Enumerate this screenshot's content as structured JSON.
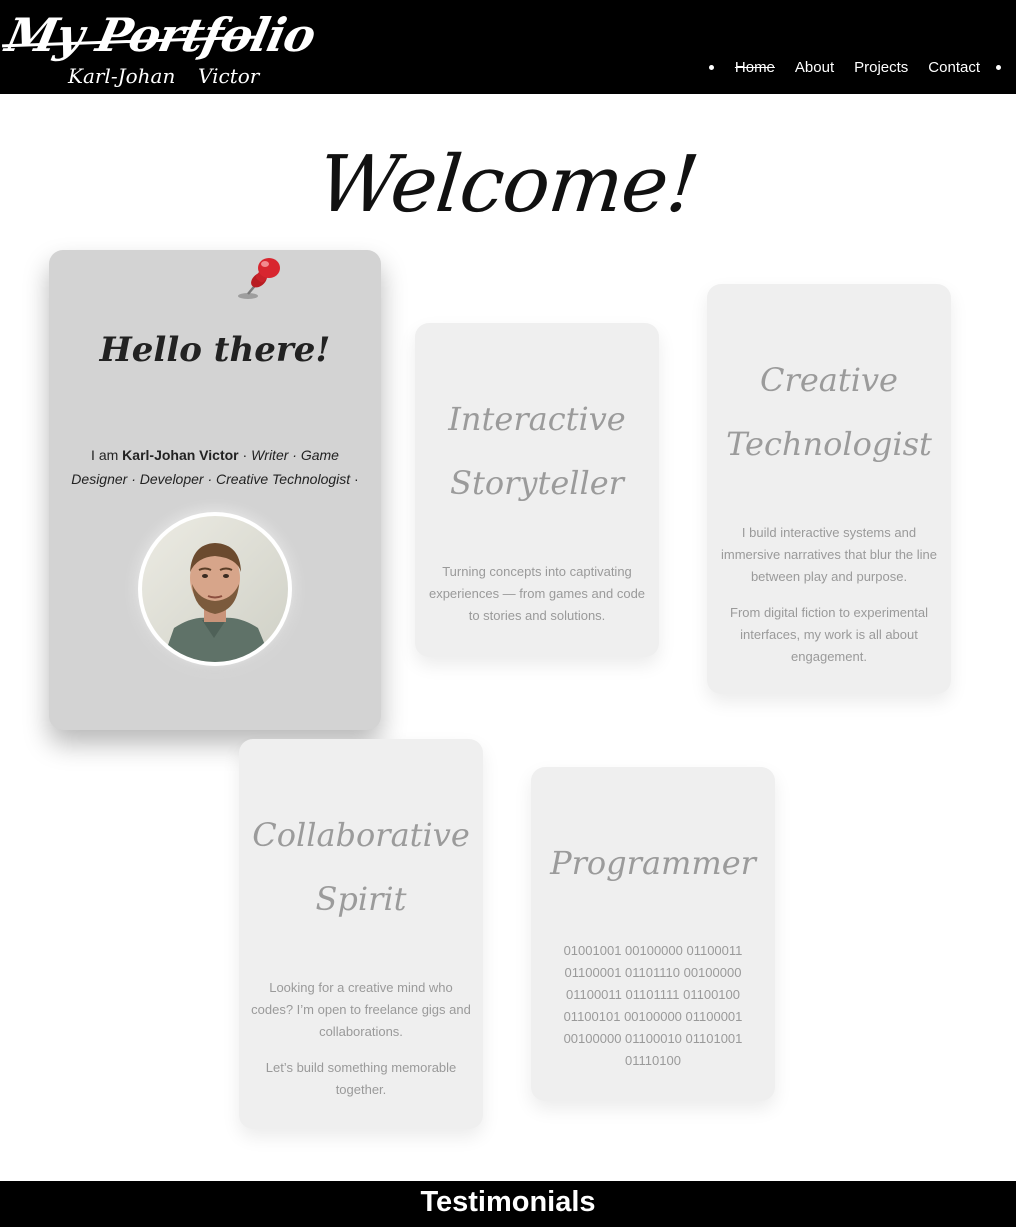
{
  "header": {
    "logo": {
      "title": "My Portfolio",
      "first_name": "Karl-Johan",
      "last_name": "Victor"
    },
    "nav": [
      {
        "label": "Home",
        "active": true
      },
      {
        "label": "About",
        "active": false
      },
      {
        "label": "Projects",
        "active": false
      },
      {
        "label": "Contact",
        "active": false
      }
    ]
  },
  "hero": {
    "title": "Welcome!"
  },
  "intro_card": {
    "heading": "Hello there!",
    "prefix": "I am ",
    "name": "Karl-Johan Victor",
    "sep1": " · ",
    "roles": "Writer · Game Designer · Developer · Creative Technologist",
    "sep2": " ·",
    "icons": {
      "pin": "pushpin-icon",
      "photo": "profile-photo"
    }
  },
  "cards": {
    "storyteller": {
      "title_line1": "Interactive",
      "title_line2": "Storyteller",
      "text": [
        "Turning concepts into captivating experiences — from games and code to stories and solutions."
      ]
    },
    "technologist": {
      "title_line1": "Creative",
      "title_line2": "Technologist",
      "text": [
        "I build interactive systems and immersive narratives that blur the line between play and purpose.",
        "From digital fiction to experimental interfaces, my work is all about engagement."
      ]
    },
    "collaborative": {
      "title_line1": "Collaborative",
      "title_line2": "Spirit",
      "text": [
        "Looking for a creative mind who codes? I’m open to freelance gigs and collaborations.",
        "Let’s build something memorable together."
      ]
    },
    "programmer": {
      "title_line1": "Programmer",
      "text": [
        "01001001 00100000 01100011 01100001 01101110 00100000 01100011 01101111 01100100 01100101 00100000 01100001 00100000 01100010 01101001 01110100"
      ]
    }
  },
  "footer_band": {
    "title": "Testimonials"
  },
  "colors": {
    "header_bg": "#000000",
    "main_card_bg": "#d3d3d3",
    "card_bg": "#efefef",
    "card_text": "#9a9a9a",
    "pin_red": "#d2232a"
  }
}
